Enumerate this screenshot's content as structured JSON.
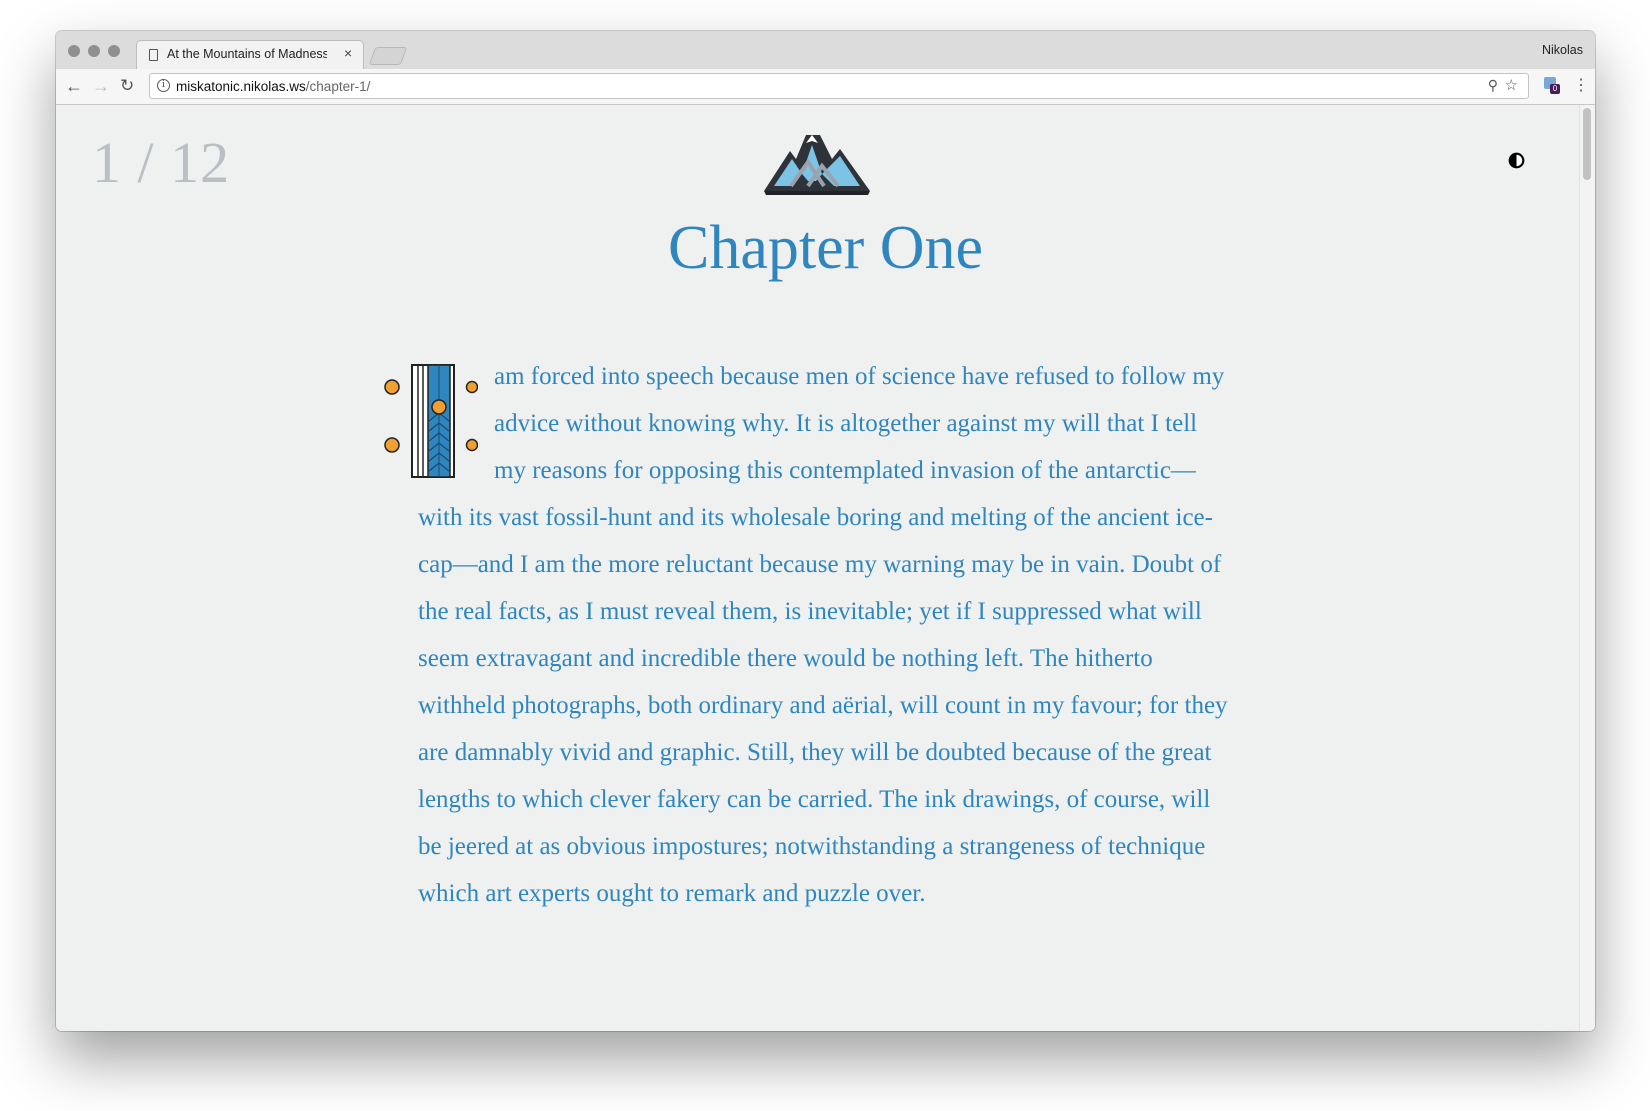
{
  "browser": {
    "tab_title": "At the Mountains of Madness",
    "tab_close": "×",
    "profile_name": "Nikolas",
    "url_host": "miskatonic.nikolas.ws",
    "url_path": "/chapter-1/",
    "extension_badge": "0"
  },
  "icons": {
    "back": "arrow-left-icon",
    "forward": "arrow-right-icon",
    "reload": "reload-icon",
    "info": "info-icon",
    "zoom": "zoom-icon",
    "bookmark": "star-icon",
    "menu": "kebab-menu-icon",
    "contrast": "contrast-toggle-icon",
    "logo": "mountains-logo"
  },
  "page": {
    "counter": "1 / 12",
    "chapter_title": "Chapter One",
    "paragraph": "am forced into speech because men of science have refused to follow my advice without knowing why. It is altogether against my will that I tell my reasons for opposing this contemplated invasion of the antarctic—with its vast fossil-hunt and its wholesale boring and melting of the ancient ice-cap—and I am the more reluctant because my warning may be in vain. Doubt of the real facts, as I must reveal them, is inevitable; yet if I suppressed what will seem extravagant and incredible there would be nothing left. The hitherto withheld photographs, both ordinary and aërial, will count in my favour; for they are damnably vivid and graphic. Still, they will be doubted because of the great lengths to which clever fakery can be carried. The ink drawings, of course, will be jeered at as obvious impostures; notwithstanding a strangeness of technique which art experts ought to remark and puzzle over.",
    "drop_cap_letter": "I"
  },
  "colors": {
    "accent": "#2f86be",
    "counter": "#b9bfc4",
    "background": "#eff0f0",
    "dropcap_dots": "#f0a030"
  }
}
